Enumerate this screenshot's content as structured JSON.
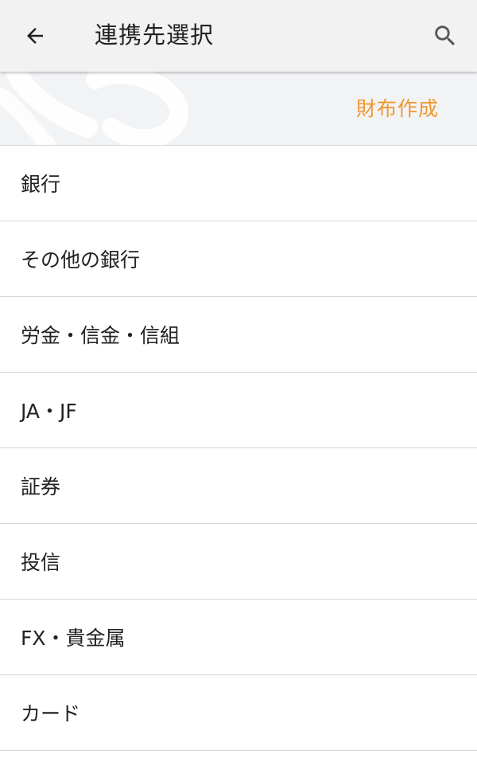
{
  "header": {
    "title": "連携先選択",
    "back_icon": "arrow-left-icon",
    "search_icon": "search-icon"
  },
  "banner": {
    "create_wallet_label": "財布作成"
  },
  "categories": [
    {
      "label": "銀行"
    },
    {
      "label": "その他の銀行"
    },
    {
      "label": "労金・信金・信組"
    },
    {
      "label": "JA・JF"
    },
    {
      "label": "証券"
    },
    {
      "label": "投信"
    },
    {
      "label": "FX・貴金属"
    },
    {
      "label": "カード"
    }
  ],
  "colors": {
    "accent": "#f0962e",
    "app_bar_bg": "#f2f2f2",
    "text": "#222222",
    "divider": "#d6d6d6"
  }
}
